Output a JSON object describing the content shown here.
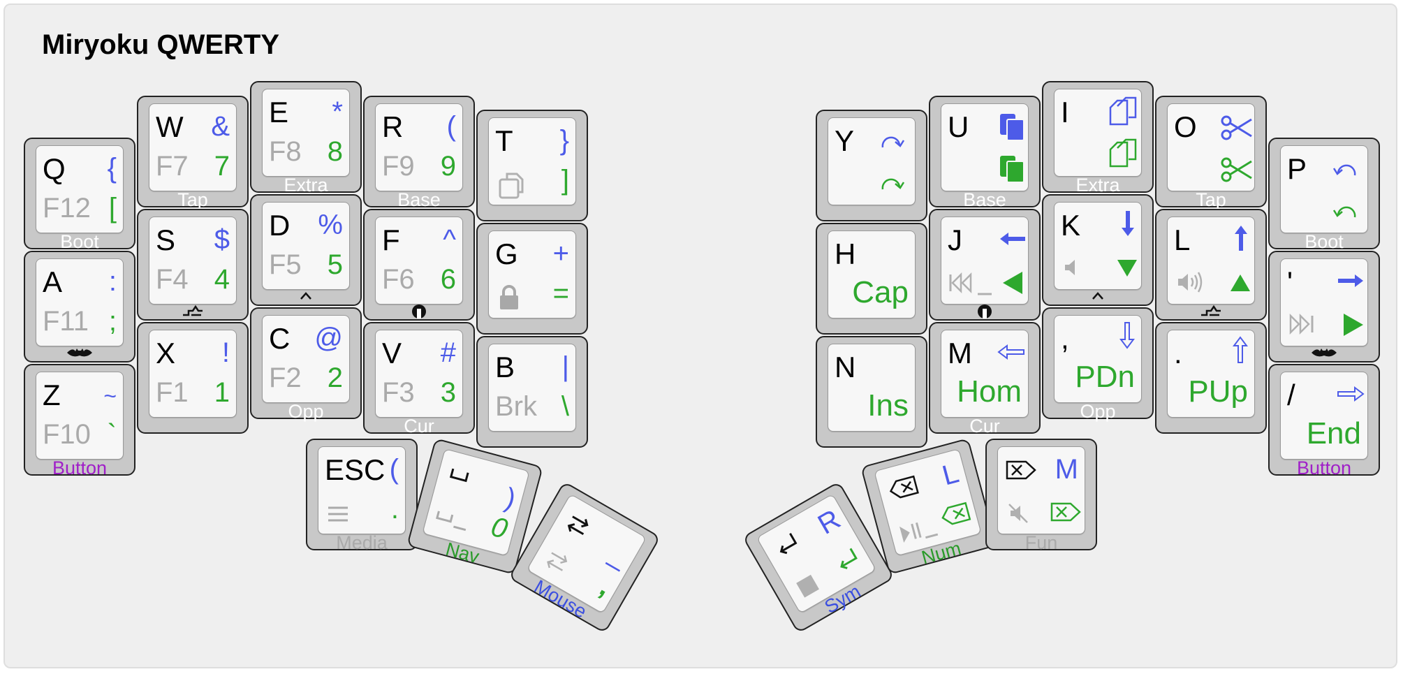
{
  "title": "Miryoku QWERTY",
  "colors": {
    "background": "#efefef",
    "keycap": "#c8c8c8",
    "keyface": "#f7f7f7",
    "blue": "#4d5be8",
    "green": "#2ea82e",
    "gray": "#aaaaaa",
    "purple": "#a020c8"
  },
  "keys": {
    "q": {
      "tl": "Q",
      "tr": "{",
      "bl": "F12",
      "br": "[",
      "below": "Boot"
    },
    "w": {
      "tl": "W",
      "tr": "&",
      "bl": "F7",
      "br": "7",
      "below": "Tap"
    },
    "e": {
      "tl": "E",
      "tr": "*",
      "bl": "F8",
      "br": "8",
      "below": "Extra"
    },
    "r": {
      "tl": "R",
      "tr": "(",
      "bl": "F9",
      "br": "9",
      "below": "Base"
    },
    "t": {
      "tl": "T",
      "tr": "}",
      "br": "]",
      "icon": "paste-icon"
    },
    "a": {
      "tl": "A",
      "tr": ":",
      "bl": "F11",
      "br": ";",
      "mark": "batman-icon"
    },
    "s": {
      "tl": "S",
      "tr": "$",
      "bl": "F4",
      "br": "4",
      "mark": "shift-icon"
    },
    "d": {
      "tl": "D",
      "tr": "%",
      "bl": "F5",
      "br": "5",
      "mark": "ctrl-icon"
    },
    "f": {
      "tl": "F",
      "tr": "^",
      "bl": "F6",
      "br": "6",
      "mark": "alt-icon"
    },
    "g": {
      "tl": "G",
      "tr": "+",
      "br": "=",
      "icon": "lock-icon"
    },
    "z": {
      "tl": "Z",
      "tr": "~",
      "bl": "F10",
      "br": "`",
      "below": "Button"
    },
    "x": {
      "tl": "X",
      "tr": "!",
      "bl": "F1",
      "br": "1"
    },
    "c": {
      "tl": "C",
      "tr": "@",
      "bl": "F2",
      "br": "2",
      "below": "Opp"
    },
    "v": {
      "tl": "V",
      "tr": "#",
      "bl": "F3",
      "br": "3",
      "below": "Cur"
    },
    "b": {
      "tl": "B",
      "tr": "|",
      "bl": "Brk",
      "br": "\\"
    },
    "esc": {
      "tl": "ESC",
      "tr": "(",
      "br": ".",
      "below": "Media",
      "icon": "menu-icon"
    },
    "space": {
      "tr": ")",
      "br": "0",
      "below": "Nav",
      "icon": "space-icon"
    },
    "tab": {
      "tr": "_",
      "br": ",",
      "below": "Mouse",
      "icon": "tab-icon"
    },
    "y": {
      "tl": "Y",
      "icon": "redo-icon"
    },
    "u": {
      "tl": "U",
      "below": "Base",
      "icon": "paste-icon"
    },
    "i": {
      "tl": "I",
      "below": "Extra",
      "icon": "copy-icon"
    },
    "o": {
      "tl": "O",
      "below": "Tap",
      "icon": "cut-icon"
    },
    "p": {
      "tl": "P",
      "below": "Boot",
      "icon": "undo-icon"
    },
    "h": {
      "tl": "H",
      "bc": "Cap"
    },
    "j": {
      "tl": "J",
      "mark": "alt-icon",
      "icon": "left-arrow-icon"
    },
    "k": {
      "tl": "K",
      "mark": "ctrl-icon",
      "icon": "down-arrow-icon"
    },
    "l": {
      "tl": "L",
      "mark": "shift-icon",
      "icon": "up-arrow-icon"
    },
    "quote": {
      "tl": "'",
      "mark": "batman-icon",
      "icon": "right-arrow-icon"
    },
    "n": {
      "tl": "N",
      "bc": "Ins"
    },
    "m": {
      "tl": "M",
      "bc": "Hom",
      "below": "Cur",
      "icon": "home-arrow-icon"
    },
    "comma": {
      "tl": ",",
      "bc": "PDn",
      "below": "Opp",
      "icon": "page-down-icon"
    },
    "period": {
      "tl": ".",
      "bc": "PUp",
      "icon": "page-up-icon"
    },
    "slash": {
      "tl": "/",
      "bc": "End",
      "below": "Button",
      "icon": "end-arrow-icon"
    },
    "enter": {
      "tr": "R",
      "below": "Sym",
      "icon": "enter-icon"
    },
    "bspc": {
      "tr": "L",
      "below": "Num",
      "icon": "backspace-icon"
    },
    "del": {
      "tr": "M",
      "below": "Fun",
      "icon": "delete-icon"
    }
  }
}
